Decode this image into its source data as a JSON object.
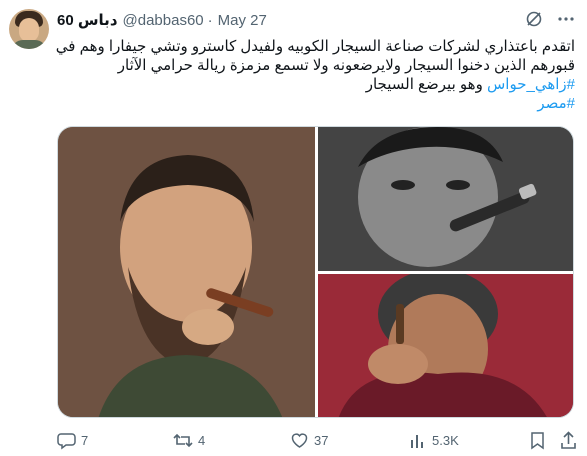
{
  "tweet": {
    "author_name": "دباس 60",
    "handle": "@dabbas60",
    "separator": "·",
    "date": "May 27",
    "text_line1": "اتقدم باعتذاري لشركات صناعة السيجار الكوبيه ولفيدل كاسترو وتشي جيفارا وهم في",
    "text_line2": "قبورهم الذين دخنوا السيجار ولايرضعونه ولا تسمع مزمزة ريالة حرامي الآثار",
    "hashtag1": "#زاهي_حواس",
    "text_line3_rest": " وهو بيرضع السيجار",
    "hashtag2": "#مصر"
  },
  "icons": {
    "grok": "grok-icon",
    "more": "more-icon"
  },
  "media": {
    "images": [
      {
        "id": "fidel",
        "subject": "man with beard smoking cigar"
      },
      {
        "id": "che",
        "subject": "black-and-white portrait with cigar"
      },
      {
        "id": "zahi",
        "subject": "man smoking cigar, red background"
      }
    ]
  },
  "actions": {
    "reply_count": "7",
    "retweet_count": "4",
    "like_count": "37",
    "views_count": "5.3K"
  },
  "colors": {
    "link": "#1d9bf0",
    "muted": "#536471",
    "text": "#0f1419"
  }
}
